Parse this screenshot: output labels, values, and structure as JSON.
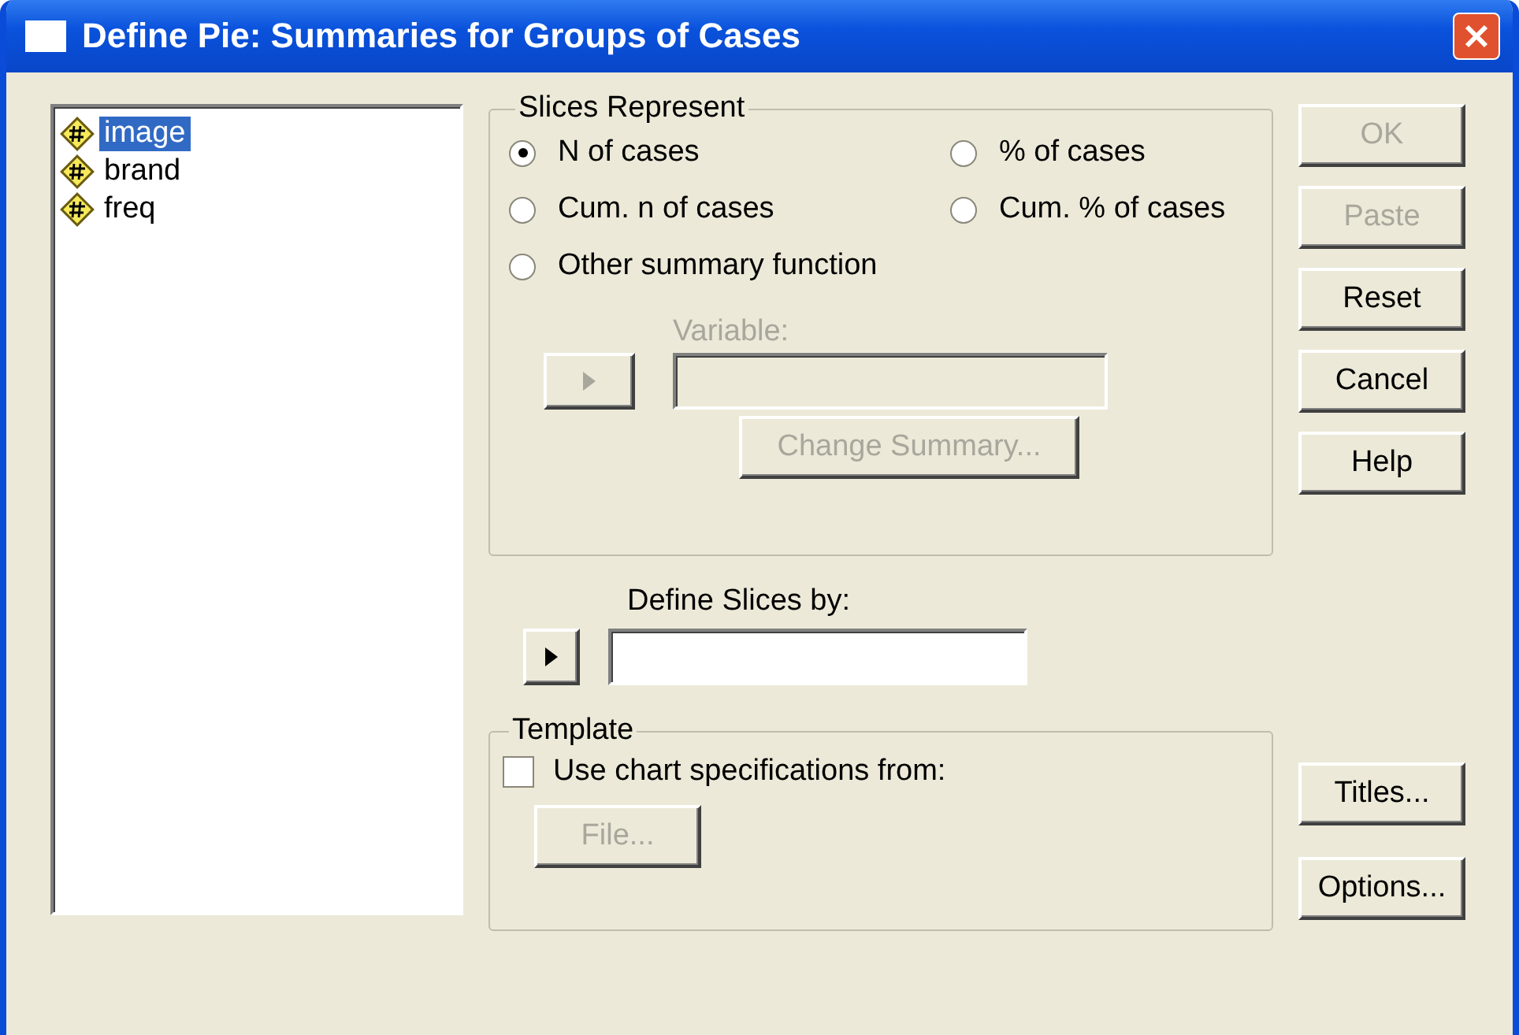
{
  "window": {
    "title": "Define Pie: Summaries for Groups of Cases"
  },
  "variables": [
    {
      "name": "image",
      "selected": true
    },
    {
      "name": "brand",
      "selected": false
    },
    {
      "name": "freq",
      "selected": false
    }
  ],
  "slices_represent": {
    "title": "Slices Represent",
    "options": [
      {
        "label": "N of cases",
        "selected": true
      },
      {
        "label": "% of cases",
        "selected": false
      },
      {
        "label": "Cum. n of cases",
        "selected": false
      },
      {
        "label": "Cum. % of cases",
        "selected": false
      },
      {
        "label": "Other summary function",
        "selected": false
      }
    ],
    "move_button": {
      "disabled": true
    },
    "variable": {
      "label": "Variable:",
      "disabled": true
    },
    "change_summary": {
      "label": "Change Summary...",
      "disabled": true
    }
  },
  "define_slices_by": {
    "label": "Define Slices by:",
    "move_button": {
      "disabled": false
    }
  },
  "template": {
    "title": "Template",
    "checkbox": {
      "label": "Use chart specifications from:",
      "checked": false
    },
    "file_button": {
      "label": "File...",
      "disabled": true
    }
  },
  "buttons": [
    {
      "label": "OK",
      "disabled": true
    },
    {
      "label": "Paste",
      "disabled": true
    },
    {
      "label": "Reset",
      "disabled": false
    },
    {
      "label": "Cancel",
      "disabled": false
    },
    {
      "label": "Help",
      "disabled": false
    }
  ],
  "side_buttons": [
    {
      "label": "Titles...",
      "disabled": false
    },
    {
      "label": "Options...",
      "disabled": false
    }
  ]
}
